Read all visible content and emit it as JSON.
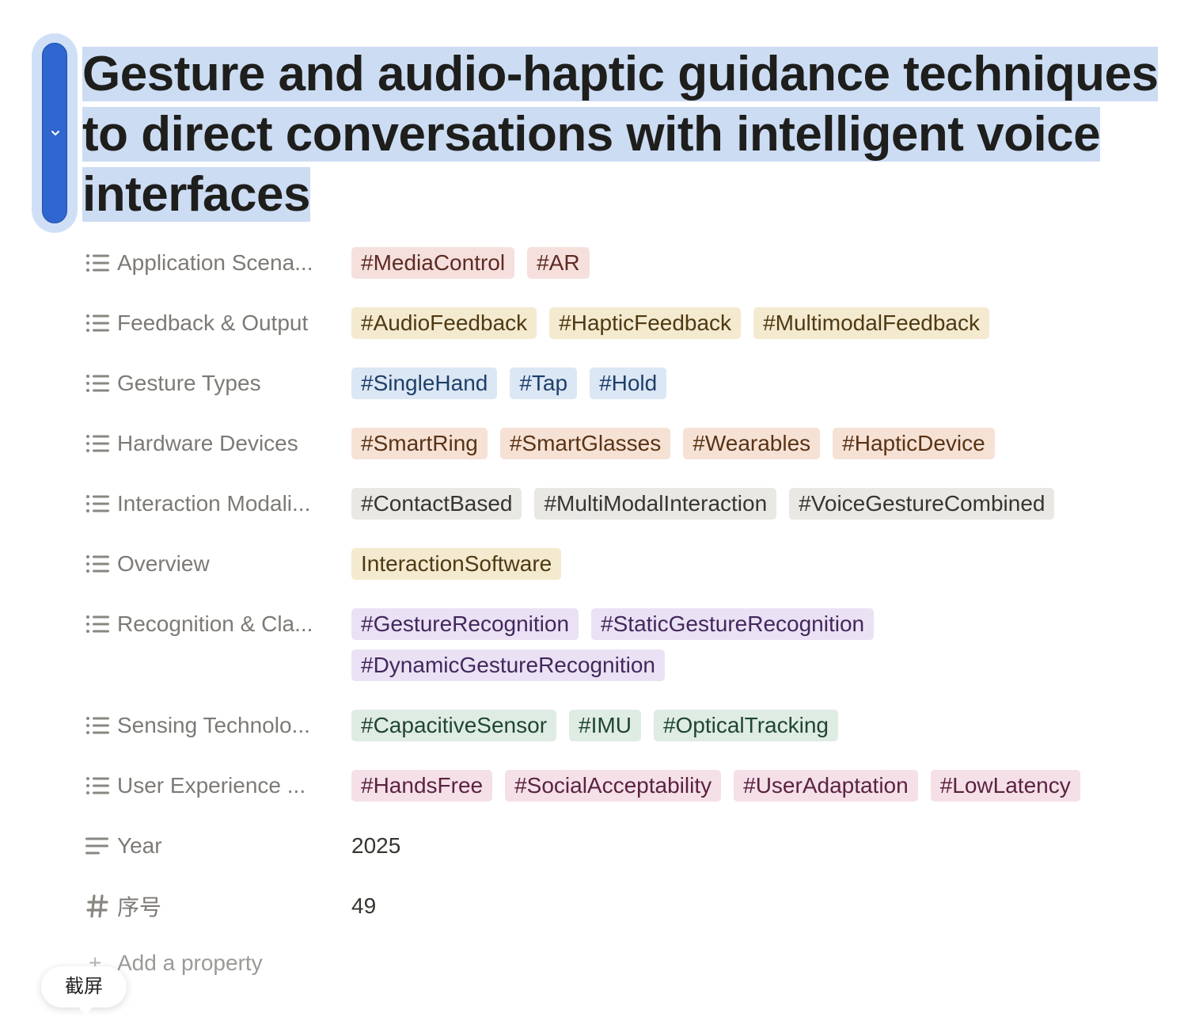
{
  "page": {
    "title": "Gesture and audio-haptic guidance techniques to direct conversations with intelligent voice interfaces"
  },
  "properties": [
    {
      "label": "Application Scena...",
      "icon": "list-icon",
      "tags": [
        {
          "text": "#MediaControl",
          "color": "red"
        },
        {
          "text": "#AR",
          "color": "red"
        }
      ]
    },
    {
      "label": "Feedback & Output",
      "icon": "list-icon",
      "tags": [
        {
          "text": "#AudioFeedback",
          "color": "yellow"
        },
        {
          "text": "#HapticFeedback",
          "color": "yellow"
        },
        {
          "text": "#MultimodalFeedback",
          "color": "yellow"
        }
      ]
    },
    {
      "label": "Gesture Types",
      "icon": "list-icon",
      "tags": [
        {
          "text": "#SingleHand",
          "color": "blue"
        },
        {
          "text": "#Tap",
          "color": "blue"
        },
        {
          "text": "#Hold",
          "color": "blue"
        }
      ]
    },
    {
      "label": "Hardware Devices",
      "icon": "list-icon",
      "tags": [
        {
          "text": "#SmartRing",
          "color": "orange"
        },
        {
          "text": "#SmartGlasses",
          "color": "orange"
        },
        {
          "text": "#Wearables",
          "color": "orange"
        },
        {
          "text": "#HapticDevice",
          "color": "orange"
        }
      ]
    },
    {
      "label": "Interaction Modali...",
      "icon": "list-icon",
      "tags": [
        {
          "text": "#ContactBased",
          "color": "gray"
        },
        {
          "text": "#MultiModalInteraction",
          "color": "gray"
        },
        {
          "text": "#VoiceGestureCombined",
          "color": "gray"
        }
      ]
    },
    {
      "label": "Overview",
      "icon": "list-icon",
      "tags": [
        {
          "text": "InteractionSoftware",
          "color": "yellow"
        }
      ]
    },
    {
      "label": "Recognition & Cla...",
      "icon": "list-icon",
      "tags": [
        {
          "text": "#GestureRecognition",
          "color": "purple"
        },
        {
          "text": "#StaticGestureRecognition",
          "color": "purple"
        },
        {
          "text": "#DynamicGestureRecognition",
          "color": "purple"
        }
      ]
    },
    {
      "label": "Sensing Technolo...",
      "icon": "list-icon",
      "tags": [
        {
          "text": "#CapacitiveSensor",
          "color": "green"
        },
        {
          "text": "#IMU",
          "color": "green"
        },
        {
          "text": "#OpticalTracking",
          "color": "green"
        }
      ]
    },
    {
      "label": "User Experience ...",
      "icon": "list-icon",
      "tags": [
        {
          "text": "#HandsFree",
          "color": "pink"
        },
        {
          "text": "#SocialAcceptability",
          "color": "pink"
        },
        {
          "text": "#UserAdaptation",
          "color": "pink"
        },
        {
          "text": "#LowLatency",
          "color": "pink"
        }
      ]
    },
    {
      "label": "Year",
      "icon": "text-lines-icon",
      "value": "2025"
    },
    {
      "label": "序号",
      "icon": "hash-icon",
      "value": "49"
    }
  ],
  "add_property": {
    "plus": "+",
    "label": "Add a property"
  },
  "tooltip": {
    "text": "截屏"
  },
  "colors": {
    "selection": "#ccdcf3",
    "handle": "#2f66cf",
    "red": "#f6e0dd",
    "yellow": "#f4ead0",
    "blue": "#dbe7f4",
    "orange": "#f6e2d5",
    "gray": "#e9e8e5",
    "purple": "#eae2f4",
    "green": "#dfece3",
    "pink": "#f5e0e8"
  }
}
